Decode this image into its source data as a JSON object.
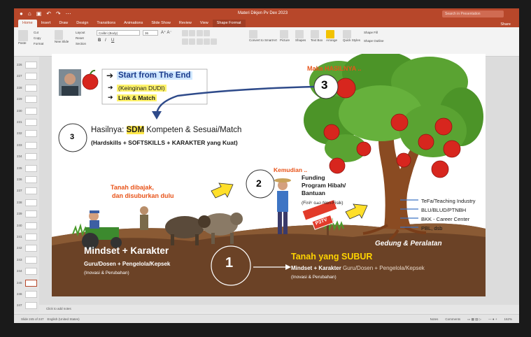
{
  "window": {
    "title": "Materi Dikjen Pv Dex 2023",
    "search_placeholder": "Search in Presentation",
    "share": "Share"
  },
  "ribbon": {
    "tabs": [
      "Home",
      "Insert",
      "Draw",
      "Design",
      "Transitions",
      "Animations",
      "Slide Show",
      "Review",
      "View",
      "Shape Format"
    ],
    "active_tab": "Home",
    "font_name": "Calibri (Body)",
    "font_size": "36",
    "paste": "Paste",
    "new_slide": "New Slide",
    "layout": "Layout",
    "reset": "Reset",
    "section": "Section",
    "cut": "Cut",
    "copy": "Copy",
    "format": "Format",
    "convert": "Convert to SmartArt",
    "picture": "Picture",
    "shapes": "Shapes",
    "text_box": "Text Box",
    "arrange": "Arrange",
    "quick_styles": "Quick Styles",
    "shape_fill": "Shape Fill",
    "shape_outline": "Shape Outline"
  },
  "thumbnails": [
    "226",
    "227",
    "228",
    "229",
    "230",
    "231",
    "232",
    "233",
    "234",
    "235",
    "236",
    "237",
    "238",
    "239",
    "240",
    "241",
    "242",
    "243",
    "244",
    "245",
    "246",
    "247"
  ],
  "selected_thumb": "245",
  "slide": {
    "start_title": "Start from The End",
    "keinginan": "(Keinginan DUDI)",
    "link_match": "Link & Match",
    "num3a": "3",
    "hasil_prefix": "Hasilnya: ",
    "sdm": "SDM",
    "hasil_rest": " Kompeten & Sesuai/Match",
    "hardskills": "(Hardskills + SOFTSKILLS + KARAKTER yang Kuat)",
    "maka": "Maka HASILNYA ..",
    "num3b": "3",
    "kemudian": "Kemudian ..",
    "num2": "2",
    "funding1": "Funding",
    "funding2": "Program Hibah/",
    "funding3": "Bantuan",
    "fisik": "(Fisik dan Non-Fisik)",
    "tanah1": "Tanah dibajak,",
    "tanah2": "dan disuburkan dulu",
    "smk_sign": "SMK-PK / CoE",
    "p3tv": "P3TV",
    "tefa": "TeFa/Teaching Industry",
    "blu": "BLU/BLUD/PTNBH",
    "bkk": "BKK - Career Center",
    "pbl": "PBL, dsb",
    "gedung": "Gedung & Peralatan",
    "mindset": "Mindset + Karakter",
    "guru": "Guru/Dosen + Pengelola/Kepsek",
    "inovasi": "(Inovasi & Perubahan)",
    "num1": "1",
    "tanah_subur": "Tanah yang SUBUR",
    "mindset2_bold": "Mindset + Karakter ",
    "mindset2_rest": "Guru/Dosen + Pengelola/Kepsek",
    "inovasi2": "(Inovasi & Perubahan)"
  },
  "notes_placeholder": "Click to add notes",
  "status": {
    "slide_info": "Slide 245 of 247",
    "language": "English (United States)",
    "notes": "Notes",
    "comments": "Comments",
    "zoom": "162%"
  },
  "colors": {
    "brand": "#b7472a",
    "orange_text": "#e8541a",
    "accent_text": "#ffd400",
    "soil": "#6b4226",
    "apple": "#d7261e"
  }
}
